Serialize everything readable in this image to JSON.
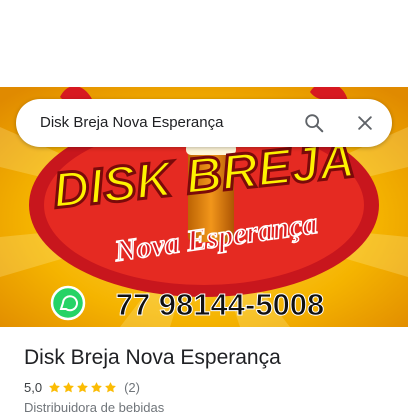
{
  "search": {
    "query": "Disk Breja Nova Esperança"
  },
  "hero": {
    "logo_line1": "DISK BREJA",
    "logo_line2": "Nova Esperança",
    "phone": "77 98144-5008"
  },
  "place": {
    "name": "Disk Breja Nova Esperança",
    "rating": "5,0",
    "star_count": 5,
    "reviews": "(2)",
    "category": "Distribuidora de bebidas"
  },
  "colors": {
    "background_yellow": "#f5b400",
    "background_red": "#c8161d",
    "logo_red": "#d71920",
    "star": "#fbbc04",
    "whatsapp_green": "#25d366"
  }
}
